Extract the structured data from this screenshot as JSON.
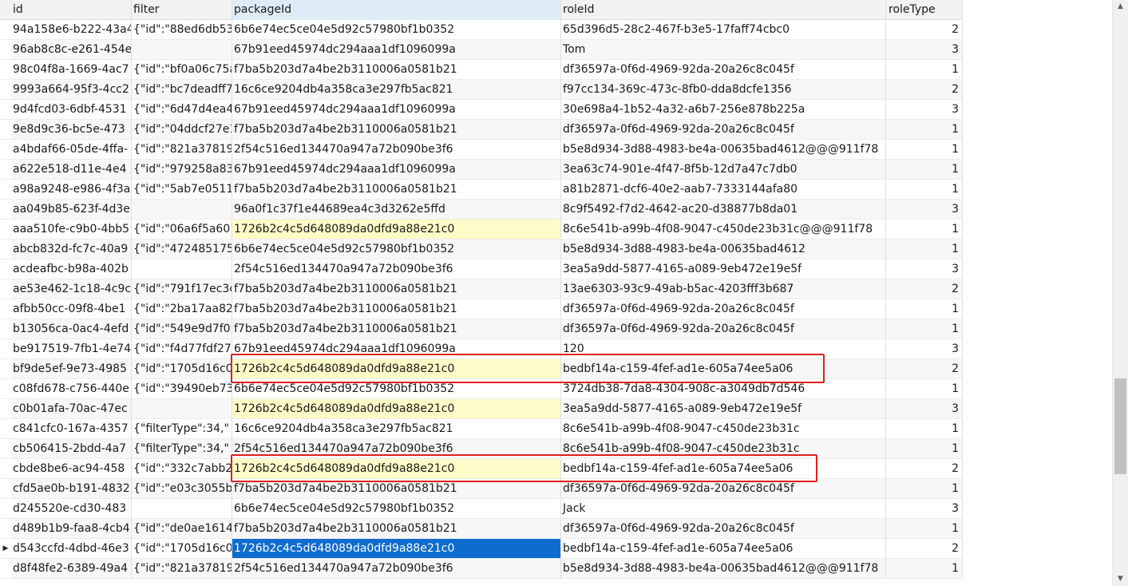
{
  "columns": [
    "id",
    "filter",
    "packageId",
    "roleId",
    "roleType"
  ],
  "rows": [
    {
      "id": "94a158e6-b222-43a4",
      "filter": "{\"id\":\"88ed6db53",
      "packageId": "6b6e74ec5ce04e5d92c57980bf1b0352",
      "roleId": "65d396d5-28c2-467f-b3e5-17faff74cbc0",
      "roleType": "2"
    },
    {
      "id": "96ab8c8c-e261-454e",
      "filter": "",
      "packageId": "67b91eed45974dc294aaa1df1096099a",
      "roleId": "Tom",
      "roleType": "3"
    },
    {
      "id": "98c04f8a-1669-4ac7",
      "filter": "{\"id\":\"bf0a06c75a",
      "packageId": "f7ba5b203d7a4be2b3110006a0581b21",
      "roleId": "df36597a-0f6d-4969-92da-20a26c8c045f",
      "roleType": "1"
    },
    {
      "id": "9993a664-95f3-4cc2",
      "filter": "{\"id\":\"bc7deadff7",
      "packageId": "16c6ce9204db4a358ca3e297fb5ac821",
      "roleId": "f97cc134-369c-473c-8fb0-dda8dcfe1356",
      "roleType": "2"
    },
    {
      "id": "9d4fcd03-6dbf-4531",
      "filter": "{\"id\":\"6d47d4ea4",
      "packageId": "67b91eed45974dc294aaa1df1096099a",
      "roleId": "30e698a4-1b52-4a32-a6b7-256e878b225a",
      "roleType": "3"
    },
    {
      "id": "9e8d9c36-bc5e-473",
      "filter": "{\"id\":\"04ddcf27e1",
      "packageId": "f7ba5b203d7a4be2b3110006a0581b21",
      "roleId": "df36597a-0f6d-4969-92da-20a26c8c045f",
      "roleType": "1"
    },
    {
      "id": "a4bdaf66-05de-4ffa-",
      "filter": "{\"id\":\"821a37819",
      "packageId": "2f54c516ed134470a947a72b090be3f6",
      "roleId": "b5e8d934-3d88-4983-be4a-00635bad4612@@@911f78",
      "roleType": "1"
    },
    {
      "id": "a622e518-d11e-4e4",
      "filter": "{\"id\":\"979258a83",
      "packageId": "67b91eed45974dc294aaa1df1096099a",
      "roleId": "3ea63c74-901e-4f47-8f5b-12d7a47c7db0",
      "roleType": "1"
    },
    {
      "id": "a98a9248-e986-4f3a",
      "filter": "{\"id\":\"5ab7e0511",
      "packageId": "f7ba5b203d7a4be2b3110006a0581b21",
      "roleId": "a81b2871-dcf6-40e2-aab7-7333144afa80",
      "roleType": "1"
    },
    {
      "id": "aa049b85-623f-4d3e",
      "filter": "",
      "packageId": "96a0f1c37f1e44689ea4c3d3262e5ffd",
      "roleId": "8c9f5492-f7d2-4642-ac20-d38877b8da01",
      "roleType": "3"
    },
    {
      "id": "aaa510fe-c9b0-4bb5",
      "filter": "{\"id\":\"06a6f5a601",
      "packageId": "1726b2c4c5d648089da0dfd9a88e21c0",
      "roleId": "8c6e541b-a99b-4f08-9047-c450de23b31c@@@911f78",
      "roleType": "1",
      "hl": true
    },
    {
      "id": "abcb832d-fc7c-40a9",
      "filter": "{\"id\":\"472485175",
      "packageId": "6b6e74ec5ce04e5d92c57980bf1b0352",
      "roleId": "b5e8d934-3d88-4983-be4a-00635bad4612",
      "roleType": "1"
    },
    {
      "id": "acdeafbc-b98a-402b",
      "filter": "",
      "packageId": "2f54c516ed134470a947a72b090be3f6",
      "roleId": "3ea5a9dd-5877-4165-a089-9eb472e19e5f",
      "roleType": "3"
    },
    {
      "id": "ae53e462-1c18-4c9c",
      "filter": "{\"id\":\"791f17ec3c",
      "packageId": "f7ba5b203d7a4be2b3110006a0581b21",
      "roleId": "13ae6303-93c9-49ab-b5ac-4203fff3b687",
      "roleType": "2"
    },
    {
      "id": "afbb50cc-09f8-4be1",
      "filter": "{\"id\":\"2ba17aa82",
      "packageId": "f7ba5b203d7a4be2b3110006a0581b21",
      "roleId": "df36597a-0f6d-4969-92da-20a26c8c045f",
      "roleType": "1"
    },
    {
      "id": "b13056ca-0ac4-4efd",
      "filter": "{\"id\":\"549e9d7f0",
      "packageId": "f7ba5b203d7a4be2b3110006a0581b21",
      "roleId": "df36597a-0f6d-4969-92da-20a26c8c045f",
      "roleType": "1"
    },
    {
      "id": "be917519-7fb1-4e74",
      "filter": "{\"id\":\"f4d77fdf27",
      "packageId": "67b91eed45974dc294aaa1df1096099a",
      "roleId": "120",
      "roleType": "3"
    },
    {
      "id": "bf9de5ef-9e73-4985",
      "filter": "{\"id\":\"1705d16c0",
      "packageId": "1726b2c4c5d648089da0dfd9a88e21c0",
      "roleId": "bedbf14a-c159-4fef-ad1e-605a74ee5a06",
      "roleType": "2",
      "hl": true
    },
    {
      "id": "c08fd678-c756-440e",
      "filter": "{\"id\":\"39490eb73",
      "packageId": "6b6e74ec5ce04e5d92c57980bf1b0352",
      "roleId": "3724db38-7da8-4304-908c-a3049db7d546",
      "roleType": "1"
    },
    {
      "id": "c0b01afa-70ac-47ec",
      "filter": "",
      "packageId": "1726b2c4c5d648089da0dfd9a88e21c0",
      "roleId": "3ea5a9dd-5877-4165-a089-9eb472e19e5f",
      "roleType": "3",
      "hl": true
    },
    {
      "id": "c841cfc0-167a-4357",
      "filter": "{\"filterType\":34,\"",
      "packageId": "16c6ce9204db4a358ca3e297fb5ac821",
      "roleId": "8c6e541b-a99b-4f08-9047-c450de23b31c",
      "roleType": "1"
    },
    {
      "id": "cb506415-2bdd-4a7",
      "filter": "{\"filterType\":34,\"",
      "packageId": "2f54c516ed134470a947a72b090be3f6",
      "roleId": "8c6e541b-a99b-4f08-9047-c450de23b31c",
      "roleType": "1"
    },
    {
      "id": "cbde8be6-ac94-458",
      "filter": "{\"id\":\"332c7abb2",
      "packageId": "1726b2c4c5d648089da0dfd9a88e21c0",
      "roleId": "bedbf14a-c159-4fef-ad1e-605a74ee5a06",
      "roleType": "2",
      "hl": true
    },
    {
      "id": "cfd5ae0b-b191-4832",
      "filter": "{\"id\":\"e03c3055b",
      "packageId": "f7ba5b203d7a4be2b3110006a0581b21",
      "roleId": "df36597a-0f6d-4969-92da-20a26c8c045f",
      "roleType": "1"
    },
    {
      "id": "d245520e-cd30-483",
      "filter": "",
      "packageId": "6b6e74ec5ce04e5d92c57980bf1b0352",
      "roleId": "Jack",
      "roleType": "3"
    },
    {
      "id": "d489b1b9-faa8-4cb4",
      "filter": "{\"id\":\"de0ae1614",
      "packageId": "f7ba5b203d7a4be2b3110006a0581b21",
      "roleId": "df36597a-0f6d-4969-92da-20a26c8c045f",
      "roleType": "1"
    },
    {
      "id": "d543ccfd-4dbd-46e3",
      "filter": "{\"id\":\"1705d16c0",
      "packageId": "1726b2c4c5d648089da0dfd9a88e21c0",
      "roleId": "bedbf14a-c159-4fef-ad1e-605a74ee5a06",
      "roleType": "2",
      "sel": true,
      "current": true
    },
    {
      "id": "d8f48fe2-6389-49a4",
      "filter": "{\"id\":\"821a37819",
      "packageId": "2f54c516ed134470a947a72b090be3f6",
      "roleId": "b5e8d934-3d88-4983-be4a-00635bad4612@@@911f78",
      "roleType": "1"
    }
  ],
  "current_row_marker": "▶",
  "annotations": [
    {
      "label": "highlight-box-row-bf9de5ef"
    },
    {
      "label": "highlight-box-row-cbde8be6"
    }
  ],
  "colors": {
    "highlight_cell": "#fdfbc7",
    "selected_cell": "#0f6ccf",
    "annotation": "#e02020",
    "header_selected": "#dfecf8"
  }
}
